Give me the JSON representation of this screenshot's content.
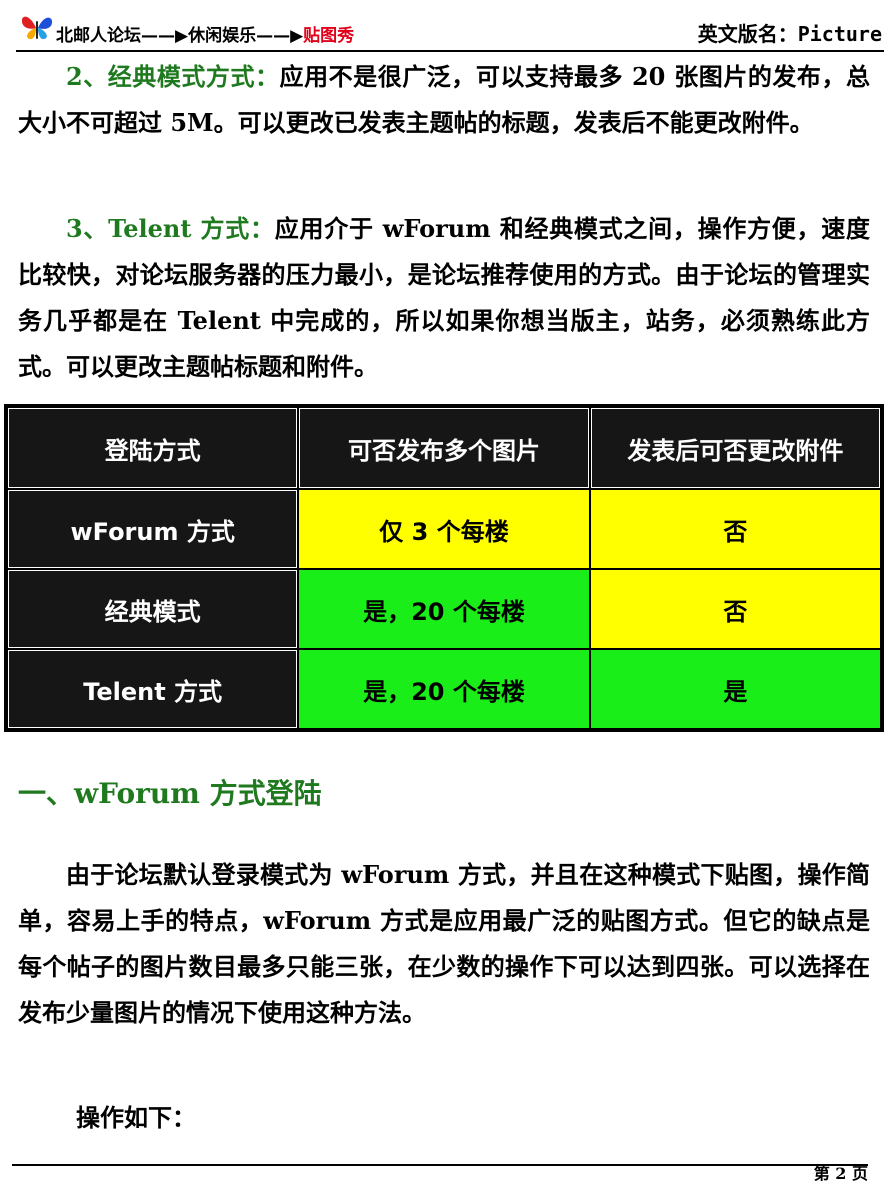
{
  "header": {
    "breadcrumb": [
      {
        "label": "北邮人论坛"
      },
      {
        "label": "休闲娱乐"
      },
      {
        "label": "贴图秀"
      }
    ],
    "arrow": "——▶",
    "board_name_label": "英文版名：",
    "board_name": "Picture"
  },
  "paragraphs": [
    {
      "lead": "2、经典模式方式：",
      "text": "应用不是很广泛，可以支持最多 20 张图片的发布，总大小不可超过 5M。可以更改已发表主题帖的标题，发表后不能更改附件。"
    },
    {
      "lead": "3、Telent 方式：",
      "text": "应用介于 wForum 和经典模式之间，操作方便，速度比较快，对论坛服务器的压力最小，是论坛推荐使用的方式。由于论坛的管理实务几乎都是在 Telent 中完成的，所以如果你想当版主，站务，必须熟练此方式。可以更改主题帖标题和附件。"
    }
  ],
  "table": {
    "headers": [
      "登陆方式",
      "可否发布多个图片",
      "发表后可否更改附件"
    ],
    "rows": [
      [
        "wForum 方式",
        "仅 3 个每楼",
        "否"
      ],
      [
        "经典模式",
        "是，20 个每楼",
        "否"
      ],
      [
        "Telent 方式",
        "是，20 个每楼",
        "是"
      ]
    ],
    "colors": {
      "yellow": "#ffff00",
      "green": "#19ee19",
      "dark": "#161616"
    }
  },
  "section": {
    "title": "一、wForum 方式登陆",
    "paragraph": "由于论坛默认登录模式为 wForum 方式，并且在这种模式下贴图，操作简单，容易上手的特点，wForum 方式是应用最广泛的贴图方式。但它的缺点是每个帖子的图片数目最多只能三张，在少数的操作下可以达到四张。可以选择在发布少量图片的情况下使用这种方法。",
    "ops_label": "操作如下："
  },
  "footer": {
    "page": "第 2 页"
  }
}
